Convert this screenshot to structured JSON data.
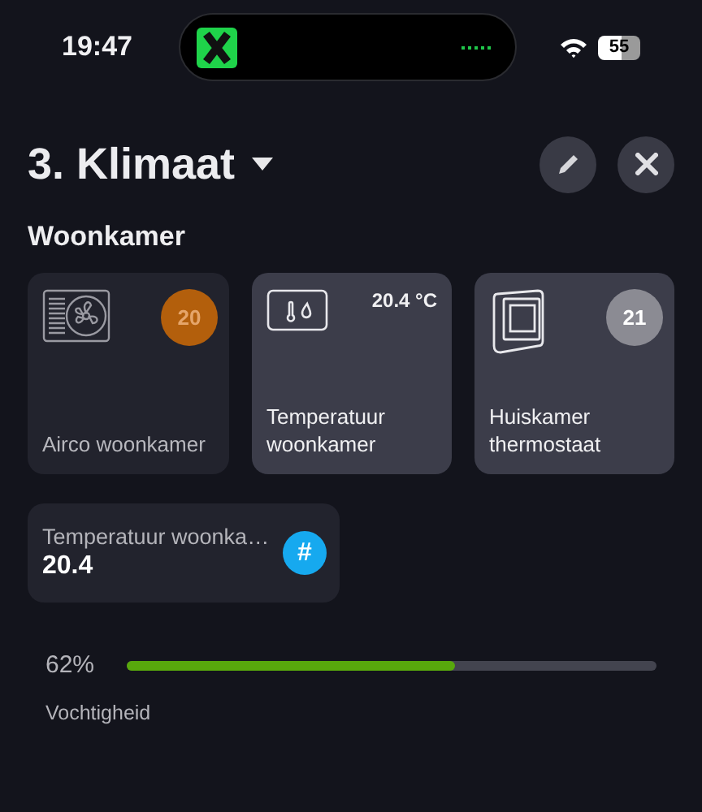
{
  "status_bar": {
    "time": "19:47",
    "battery": "55"
  },
  "header": {
    "title": "3. Klimaat"
  },
  "section": {
    "title": "Woonkamer"
  },
  "tiles": [
    {
      "kind": "airco",
      "label": "Airco woonkamer",
      "badge": "20",
      "color": "#b35f0c",
      "on": false
    },
    {
      "kind": "sensor",
      "label": "Temperatuur woonkamer",
      "reading": "20.4 °C",
      "on": true
    },
    {
      "kind": "thermostat",
      "label": "Huiskamer thermostaat",
      "badge": "21",
      "color": "#8b8b93",
      "on": true
    }
  ],
  "number_card": {
    "label": "Temperatuur woonka…",
    "value": "20.4",
    "icon": "#"
  },
  "humidity": {
    "reading": "62%",
    "level": 0.62,
    "label": "Vochtigheid"
  }
}
